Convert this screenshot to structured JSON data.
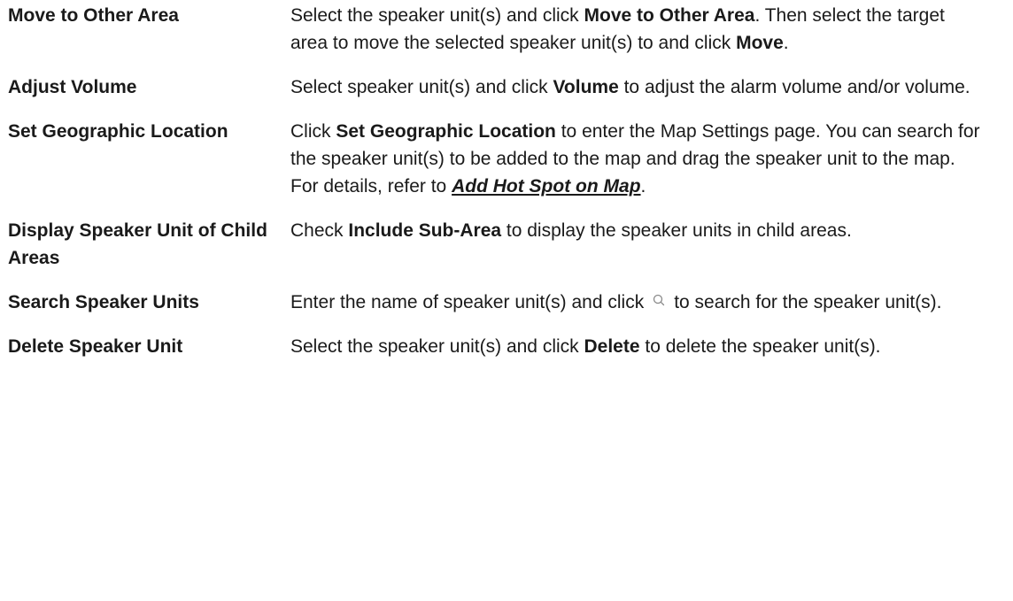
{
  "rows": [
    {
      "term": "Move to Other Area",
      "desc": {
        "p1": "Select the speaker unit(s) and click ",
        "b1": "Move to Other Area",
        "p2": ". Then select the target area to move the selected speaker unit(s) to and click ",
        "b2": "Move",
        "p3": "."
      }
    },
    {
      "term": "Adjust Volume",
      "desc": {
        "p1": "Select speaker unit(s) and click ",
        "b1": "Volume",
        "p2": " to adjust the alarm volume and/or volume."
      }
    },
    {
      "term": "Set Geographic Location",
      "desc": {
        "p1": "Click ",
        "b1": "Set Geographic Location",
        "p2": " to enter the Map Settings page. You can search for the speaker unit(s) to be added to the map and drag the speaker unit to the map. For details, refer to ",
        "link": "Add Hot Spot on Map",
        "p3": "."
      }
    },
    {
      "term": "Display Speaker Unit of Child Areas",
      "desc": {
        "p1": "Check ",
        "b1": "Include Sub-Area",
        "p2": " to display the speaker units in child areas."
      }
    },
    {
      "term": "Search Speaker Units",
      "desc": {
        "p1": "Enter the name of speaker unit(s) and click",
        "icon": "search-icon",
        "p2": "to search for the speaker unit(s)."
      }
    },
    {
      "term": "Delete Speaker Unit",
      "desc": {
        "p1": "Select the speaker unit(s) and click ",
        "b1": "Delete",
        "p2": " to delete the speaker unit(s)."
      }
    }
  ]
}
